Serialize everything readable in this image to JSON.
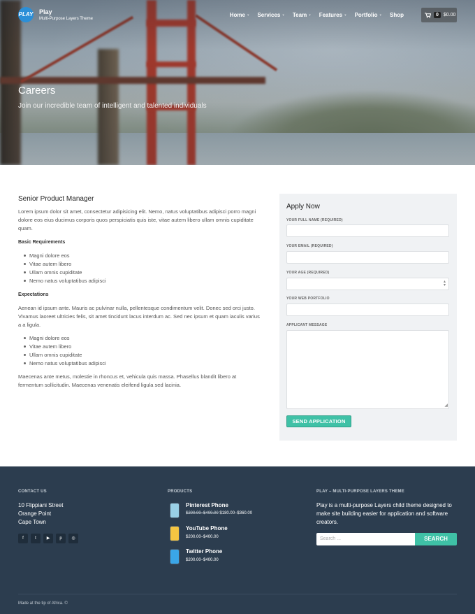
{
  "header": {
    "logo_badge": "PLAY",
    "brand_name": "Play",
    "tagline": "Multi-Purpose Layers Theme",
    "nav": [
      {
        "label": "Home",
        "has_dropdown": true
      },
      {
        "label": "Services",
        "has_dropdown": true
      },
      {
        "label": "Team",
        "has_dropdown": true
      },
      {
        "label": "Features",
        "has_dropdown": true
      },
      {
        "label": "Portfolio",
        "has_dropdown": true
      },
      {
        "label": "Shop",
        "has_dropdown": false
      }
    ],
    "cart": {
      "count": "0",
      "total": "$0.00",
      "icon": "cart-icon"
    }
  },
  "hero": {
    "title": "Careers",
    "subtitle": "Join our incredible team of intelligent and talented individuals"
  },
  "job": {
    "title": "Senior Product Manager",
    "intro": "Lorem ipsum dolor sit amet, consectetur adipisicing elit. Nemo, natus voluptatibus adipisci porro magni dolore eos eius ducimus corporis quos perspiciatis quis iste, vitae autem libero ullam omnis cupiditate quam.",
    "requirements_heading": "Basic Requirements",
    "requirements": [
      "Magni dolore eos",
      "Vitae autem libero",
      "Ullam omnis cupiditate",
      "Nemo natus voluptatibus adipisci"
    ],
    "expectations_heading": "Expectations",
    "expectations_text": "Aenean id ipsum ante. Mauris ac pulvinar nulla, pellentesque condimentum velit. Donec sed orci justo. Vivamus laoreet ultricies felis, sit amet tincidunt lacus interdum ac. Sed nec ipsum et quam iaculis varius a a ligula.",
    "expectations": [
      "Magni dolore eos",
      "Vitae autem libero",
      "Ullam omnis cupiditate",
      "Nemo natus voluptatibus adipisci"
    ],
    "closing": "Maecenas ante metus, molestie in rhoncus et, vehicula quis massa. Phasellus blandit libero at fermentum sollicitudin. Maecenas venenatis eleifend ligula sed lacinia."
  },
  "apply": {
    "title": "Apply Now",
    "fields": [
      {
        "label": "YOUR FULL NAME (REQUIRED)",
        "value": ""
      },
      {
        "label": "YOUR EMAIL (REQUIRED)",
        "value": ""
      },
      {
        "label": "YOUR AGE (REQUIRED)",
        "value": ""
      },
      {
        "label": "YOUR WEB PORTFOLIO",
        "value": ""
      }
    ],
    "message_label": "APPLICANT MESSAGE",
    "message_value": "",
    "submit_label": "SEND APPLICATION"
  },
  "footer": {
    "contact_heading": "CONTACT US",
    "address": [
      "10 Flippiani Street",
      "Orange Point",
      "Cape Town"
    ],
    "social": [
      {
        "icon": "facebook-icon",
        "glyph": "f"
      },
      {
        "icon": "twitter-icon",
        "glyph": "t"
      },
      {
        "icon": "youtube-icon",
        "glyph": "▶"
      },
      {
        "icon": "pinterest-icon",
        "glyph": "p"
      },
      {
        "icon": "dribbble-icon",
        "glyph": "◎"
      }
    ],
    "products_heading": "PRODUCTS",
    "products": [
      {
        "name": "Pinterest Phone",
        "old_price": "$200.00–$400.00",
        "price": "$180.00–$360.00",
        "color": "#9ad0e6"
      },
      {
        "name": "YouTube Phone",
        "old_price": "",
        "price": "$200.00–$400.00",
        "color": "#f4c542"
      },
      {
        "name": "Twitter Phone",
        "old_price": "",
        "price": "$200.00–$400.00",
        "color": "#3aa6e8"
      }
    ],
    "about_heading": "PLAY – MULTI-PURPOSE LAYERS THEME",
    "about_text": "Play is a multi-purpose Layers child theme designed to make site building easier for application and software creators.",
    "search_placeholder": "Search ...",
    "search_button": "SEARCH",
    "copyright": "Made at the tip of Africa. ©"
  },
  "colors": {
    "accent": "#3fc1a6",
    "footer_bg": "#2c3d4f",
    "form_bg": "#f0f2f4"
  }
}
